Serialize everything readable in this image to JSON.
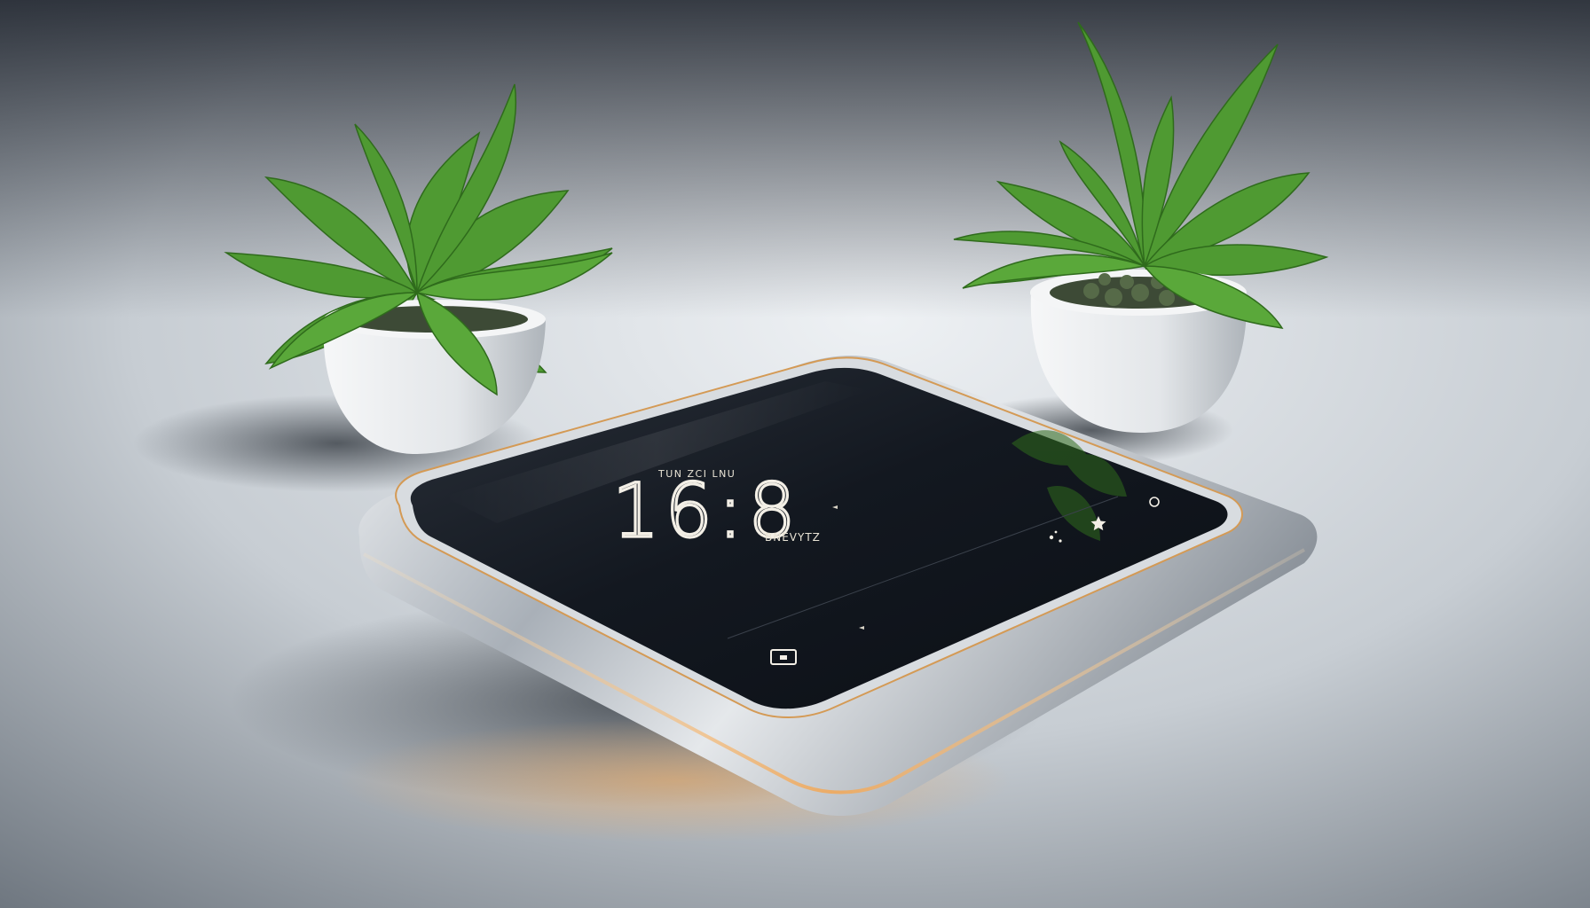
{
  "scene": {
    "subject": "smart-display-device",
    "accent_color": "#d49a55",
    "leaf_color": "#4f9a32",
    "pot_color": "#e8eaec"
  },
  "device": {
    "screen": {
      "top_caption": "TUN ZCI LNU",
      "time": "16:8",
      "sub_caption": "BNEVYTZ",
      "icons": [
        "square-icon",
        "star-icon",
        "sparkle-icon",
        "circle-icon",
        "button-icon"
      ]
    }
  }
}
